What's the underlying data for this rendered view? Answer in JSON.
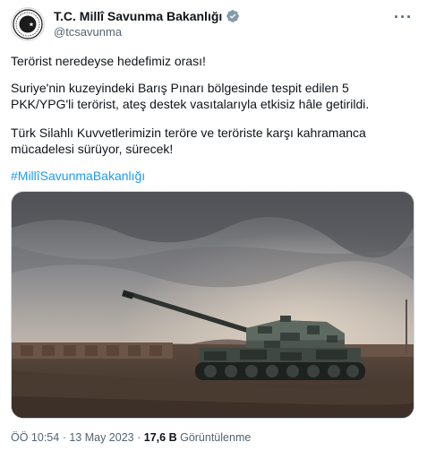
{
  "author": {
    "display_name": "T.C. Millî Savunma Bakanlığı",
    "handle": "@tcsavunma",
    "verified": true,
    "avatar_icon": "ministry-emblem-icon"
  },
  "menu": {
    "more_label": "···"
  },
  "tweet": {
    "paragraph_1": "Terörist neredeyse hedefimiz orası!",
    "paragraph_2": "Suriye'nin kuzeyindeki Barış Pınarı bölgesinde tespit edilen 5 PKK/YPG'li terörist, ateş destek vasıtalarıyla etkisiz hâle getirildi.",
    "paragraph_3": "Türk Silahlı Kuvvetlerimizin teröre ve teröriste karşı kahramanca mücadelesi sürüyor, sürecek!",
    "hashtag": "#MillîSavunmaBakanlığı"
  },
  "media": {
    "type": "photo",
    "subject": "self-propelled-howitzer"
  },
  "meta": {
    "time": "ÖÖ 10:54",
    "separator": "·",
    "date": "13 May 2023",
    "views_count": "17,6 B",
    "views_label": "Görüntülenme"
  },
  "colors": {
    "link": "#1d9bf0",
    "verified": "#829aab",
    "secondary_text": "#536471"
  }
}
